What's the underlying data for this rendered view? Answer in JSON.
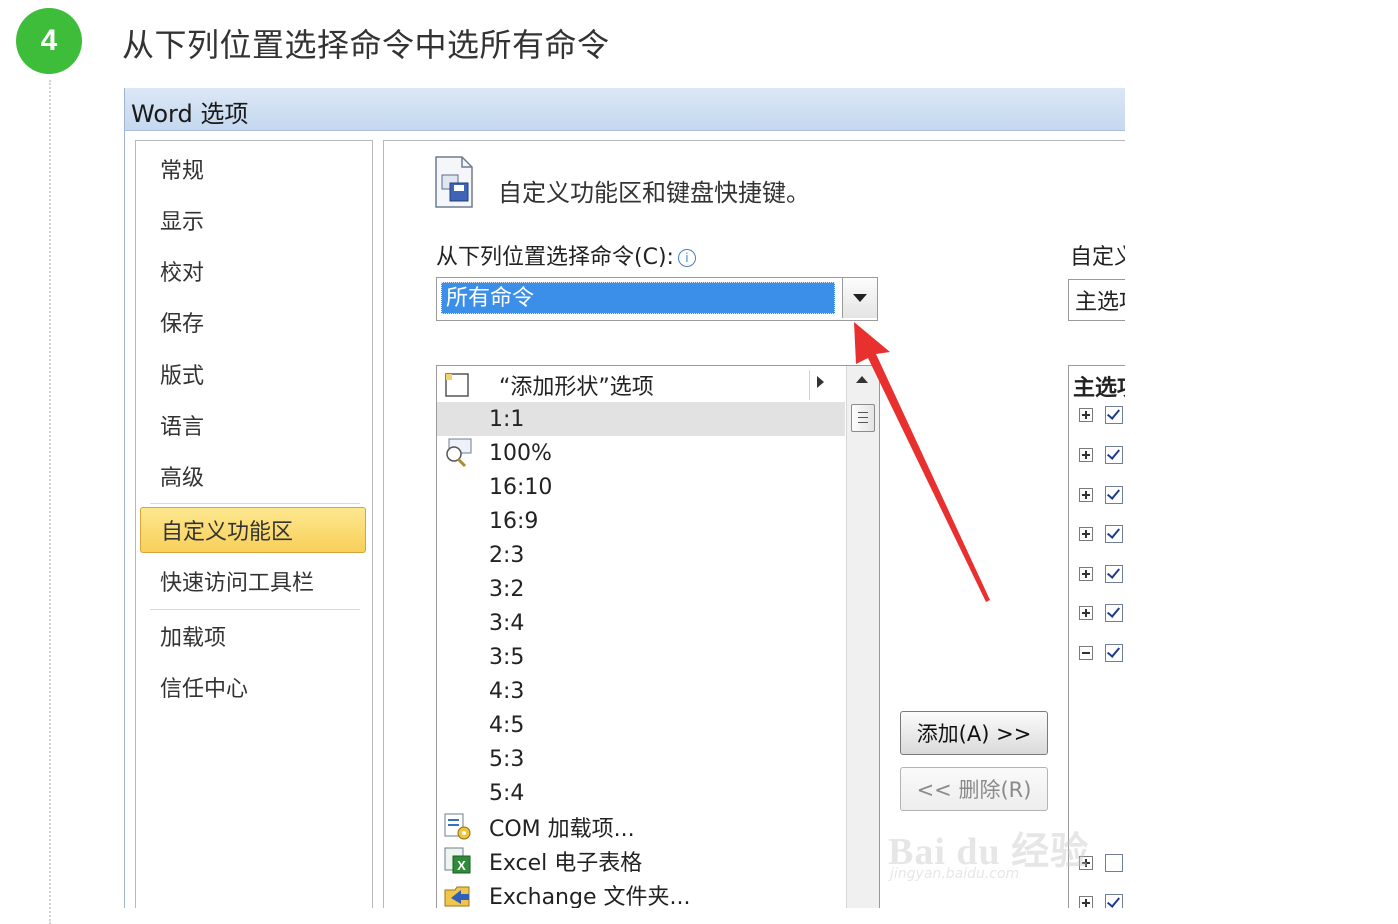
{
  "step": {
    "number": "4",
    "title": "从下列位置选择命令中选所有命令"
  },
  "dialog": {
    "title": "Word 选项"
  },
  "nav": {
    "items": [
      {
        "label": "常规"
      },
      {
        "label": "显示"
      },
      {
        "label": "校对"
      },
      {
        "label": "保存"
      },
      {
        "label": "版式"
      },
      {
        "label": "语言"
      },
      {
        "label": "高级"
      },
      {
        "label": "自定义功能区",
        "selected": true
      },
      {
        "label": "快速访问工具栏"
      },
      {
        "label": "加载项"
      },
      {
        "label": "信任中心"
      }
    ]
  },
  "pane": {
    "heading": "自定义功能区和键盘快捷键。",
    "choose_label": "从下列位置选择命令(C):",
    "info_glyph": "i",
    "choose_value": "所有命令",
    "right_label": "自定义功能区",
    "right_value": "主选项卡"
  },
  "commands": [
    {
      "label": "“添加形状”选项",
      "icon": "shape-icon",
      "submenu": true
    },
    {
      "label": "1:1",
      "selected": true
    },
    {
      "label": "100%",
      "icon": "zoom-100-icon"
    },
    {
      "label": "16:10"
    },
    {
      "label": "16:9"
    },
    {
      "label": "2:3"
    },
    {
      "label": "3:2"
    },
    {
      "label": "3:4"
    },
    {
      "label": "3:5"
    },
    {
      "label": "4:3"
    },
    {
      "label": "4:5"
    },
    {
      "label": "5:3"
    },
    {
      "label": "5:4"
    },
    {
      "label": "COM 加载项...",
      "icon": "com-addin-icon"
    },
    {
      "label": "Excel 电子表格",
      "icon": "excel-icon"
    },
    {
      "label": "Exchange 文件夹...",
      "icon": "exchange-folder-icon"
    }
  ],
  "buttons": {
    "add": "添加(A) >>",
    "remove": "<< 删除(R)"
  },
  "tree": {
    "header": "主选项卡"
  },
  "watermark": {
    "text": "Bai du 经验",
    "sub": "jingyan.baidu.com"
  },
  "colors": {
    "step_green": "#3ebd3a",
    "selection_blue": "#3b8fe8",
    "nav_selected_gold": "#f8cf5a",
    "arrow_red": "#e8312f"
  }
}
